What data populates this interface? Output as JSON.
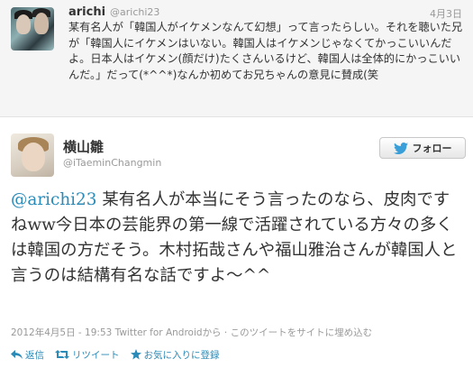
{
  "reply": {
    "name": "arichi",
    "handle": "@arichi23",
    "date": "4月3日",
    "text": "某有名人が「韓国人がイケメンなんて幻想」って言ったらしい。それを聴いた兄が「韓国人にイケメンはいない。韓国人はイケメンじゃなくてかっこいいんだよ。日本人はイケメン(顔だけ)たくさんいるけど、韓国人は全体的にかっこいいんだ。」だって(*^^*)なんか初めてお兄ちゃんの意見に賛成(笑"
  },
  "tweet": {
    "name": "横山雛",
    "handle": "@iTaeminChangmin",
    "follow_label": "フォロー",
    "mention": "@arichi23",
    "text": " 某有名人が本当にそう言ったのなら、皮肉ですねww今日本の芸能界の第一線で活躍されている方々の多くは韓国の方だそう。木村拓哉さんや福山雅治さんが韓国人と言うのは結構有名な話ですよ～^^",
    "timestamp": "2012年4月5日 - 19:53",
    "source": "Twitter for Android",
    "source_suffix": "から · ",
    "embed_label": "このツイートをサイトに埋め込む"
  },
  "actions": {
    "reply_label": "返信",
    "retweet_label": "リツイート",
    "favorite_label": "お気に入りに登録"
  },
  "colors": {
    "link": "#2a8ab8",
    "muted": "#999999",
    "reply_bg": "#f5f5f5"
  }
}
